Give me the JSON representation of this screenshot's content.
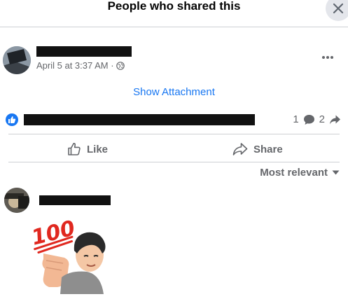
{
  "header": {
    "title": "People who shared this"
  },
  "post": {
    "timestamp": "April 5 at 3:37 AM · ",
    "attachment_link": "Show Attachment",
    "comment_count": "1",
    "share_count": "2"
  },
  "actions": {
    "like_label": "Like",
    "share_label": "Share"
  },
  "comments": {
    "sort_label": "Most relevant"
  },
  "colors": {
    "accent": "#1877f2",
    "secondary_text": "#65676b",
    "divider": "#ced0d4",
    "sticker_red": "#e0281f"
  },
  "icons": [
    "close-icon",
    "globe-icon",
    "more-icon",
    "like-reaction-icon",
    "comment-icon",
    "share-arrow-icon",
    "thumbs-up-icon",
    "share-icon",
    "caret-down-icon",
    "hundred-sticker"
  ]
}
